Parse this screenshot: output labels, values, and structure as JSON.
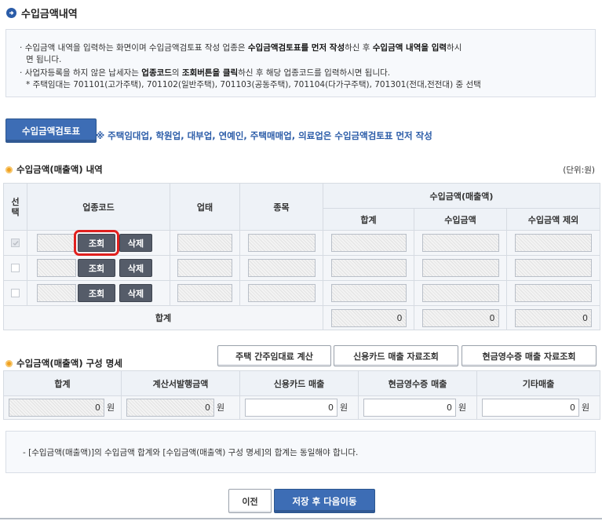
{
  "page": {
    "title": "수입금액내역"
  },
  "notice": {
    "line1_a": "수입금액 내역을 입력하는 화면이며 수입금액검토표 작성 업종은 ",
    "line1_b": "수입금액검토표를 먼저 작성",
    "line1_c": "하신 후 ",
    "line1_d": "수입금액 내역을 입력",
    "line1_e": "하시",
    "line1_f": "면 됩니다.",
    "line2_a": "사업자등록을 하지 않은 납세자는 ",
    "line2_b": "업종코드",
    "line2_c": "의 ",
    "line2_d": "조회버튼을 클릭",
    "line2_e": "하신 후 해당 업종코드를 입력하시면 됩니다.",
    "line3": "* 주택임대는 701101(고가주택), 701102(일반주택), 701103(공동주택), 701104(다가구주택), 701301(전대,전전대) 중 선택"
  },
  "review_button": "수입금액검토표",
  "review_note": "※ 주택임대업, 학원업, 대부업, 연예인, 주택매매업, 의료업은 수입금액검토표 먼저 작성",
  "section1": {
    "title": "수입금액(매출액) 내역",
    "unit": "(단위:원)",
    "headers": {
      "select": "선택",
      "code": "업종코드",
      "type": "업태",
      "item": "종목",
      "revenue": "수입금액(매출액)",
      "total": "합계",
      "income": "수입금액",
      "excluded": "수입금액 제외"
    },
    "row_buttons": {
      "lookup": "조회",
      "delete": "삭제"
    },
    "total_label": "합계",
    "totals": {
      "total": "0",
      "income": "0",
      "excluded": "0"
    }
  },
  "section2": {
    "title": "수입금액(매출액) 구성 명세",
    "buttons": {
      "housing": "주택 간주임대료 계산",
      "card": "신용카드 매출 자료조회",
      "cash": "현금영수증 매출 자료조회"
    },
    "headers": [
      "합계",
      "계산서발행금액",
      "신용카드 매출",
      "현금영수증 매출",
      "기타매출"
    ],
    "values": [
      "0",
      "0",
      "0",
      "0",
      "0"
    ],
    "won": "원"
  },
  "bottom_note": "- [수입금액(매출액)]의 수입금액 합계와 [수입금액(매출액) 구성 명세]의 합계는 동일해야 합니다.",
  "nav": {
    "prev": "이전",
    "next": "저장 후 다음이동"
  },
  "colors": {
    "accent_blue": "#3d6db5",
    "dark_button": "#555c69",
    "highlight_red": "#e0201e"
  }
}
